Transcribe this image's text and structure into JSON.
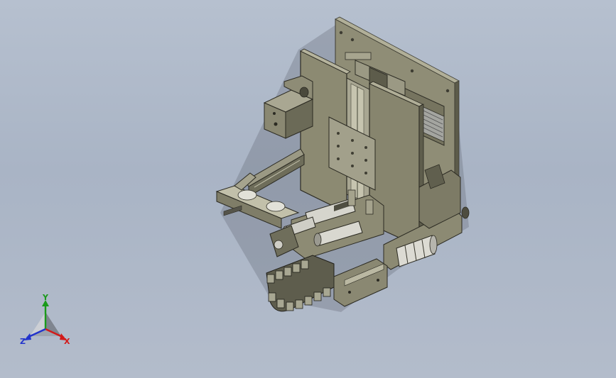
{
  "triad": {
    "x_label": "X",
    "y_label": "Y",
    "z_label": "Z",
    "x_color": "#d21a1a",
    "y_color": "#1a9a1a",
    "z_color": "#2233cc"
  },
  "colors": {
    "background_top": "#b6c0cf",
    "background_bottom": "#a9b4c5",
    "part_body": "#8d8b73",
    "part_shadow": "#5f5d4c",
    "part_light": "#b3b19b"
  }
}
